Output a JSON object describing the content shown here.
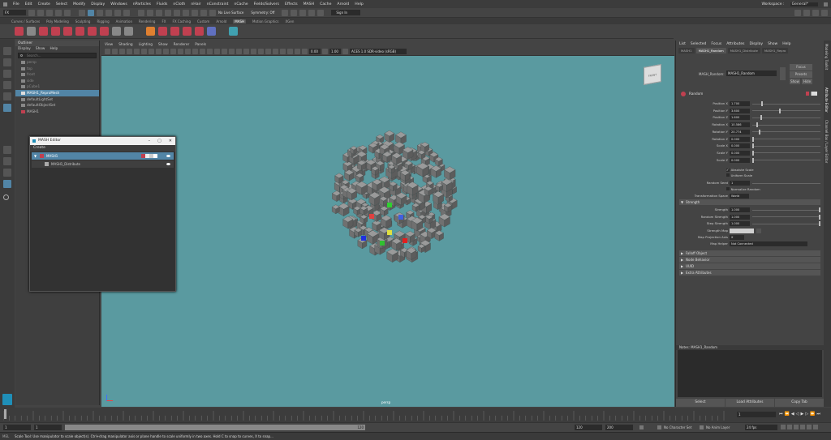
{
  "menubar": {
    "items": [
      "File",
      "Edit",
      "Create",
      "Select",
      "Modify",
      "Display",
      "Windows",
      "nParticles",
      "Fluids",
      "nCloth",
      "nHair",
      "nConstraint",
      "nCache",
      "Fields/Solvers",
      "Effects",
      "MASH",
      "Cache",
      "Arnold",
      "Help"
    ],
    "workspace_label": "Workspace :",
    "workspace_value": "General*"
  },
  "statusline": {
    "mode": "FX",
    "live_surface": "No Live Surface",
    "symmetry": "Symmetry: Off",
    "sign_in": "Sign In"
  },
  "shelf_tabs": [
    "Curves / Surfaces",
    "Poly Modeling",
    "Sculpting",
    "Rigging",
    "Animation",
    "Rendering",
    "FX",
    "FX Caching",
    "Custom",
    "Arnold",
    "MASH",
    "Motion Graphics",
    "XGen"
  ],
  "shelf_active": "MASH",
  "outliner": {
    "title": "Outliner",
    "menu": [
      "Display",
      "Show",
      "Help"
    ],
    "search_placeholder": "Search...",
    "items": [
      {
        "label": "persp",
        "selected": false
      },
      {
        "label": "top",
        "selected": false
      },
      {
        "label": "front",
        "selected": false
      },
      {
        "label": "side",
        "selected": false
      },
      {
        "label": "pCube1",
        "selected": false
      },
      {
        "label": "MASH1_ReproMesh",
        "selected": true
      },
      {
        "label": "defaultLightSet",
        "selected": false
      },
      {
        "label": "defaultObjectSet",
        "selected": false
      },
      {
        "label": "MASH1",
        "selected": false
      }
    ]
  },
  "viewport": {
    "menu": [
      "View",
      "Shading",
      "Lighting",
      "Show",
      "Renderer",
      "Panels"
    ],
    "exposure": "0.00",
    "gamma": "1.00",
    "colorspace": "ACES 1.0 SDR-video (sRGB)",
    "camera_label": "persp",
    "viewcube_label": "FRONT"
  },
  "mash_editor": {
    "title": "MASH Editor",
    "menu": "Create",
    "network": "MASH1",
    "node": "MASH1_Distribute",
    "controls": [
      "–",
      "▢",
      "✕"
    ]
  },
  "attribute_editor": {
    "menu": [
      "List",
      "Selected",
      "Focus",
      "Attributes",
      "Display",
      "Show",
      "Help"
    ],
    "tabs": [
      "MASH1",
      "MASH1_Random",
      "MASH1_Distribute",
      "MASH1_Repro"
    ],
    "active_tab": "MASH1_Random",
    "node_label": "MASH_Random:",
    "node_value": "MASH1_Random",
    "focus_label": "Focus",
    "presets_label": "Presets",
    "show_label": "Show",
    "hide_label": "Hide",
    "section_random": "Random",
    "fields": [
      {
        "label": "Position X",
        "value": "1.700",
        "fraction": 0.14
      },
      {
        "label": "Position Y",
        "value": "3.600",
        "fraction": 0.4
      },
      {
        "label": "Position Z",
        "value": "1.600",
        "fraction": 0.12
      },
      {
        "label": "Rotation X",
        "value": "10.586",
        "fraction": 0.06
      },
      {
        "label": "Rotation Y",
        "value": "20.774",
        "fraction": 0.1
      },
      {
        "label": "Rotation Z",
        "value": "0.000",
        "fraction": 0.0
      },
      {
        "label": "Scale X",
        "value": "0.000",
        "fraction": 0.0
      },
      {
        "label": "Scale Y",
        "value": "0.000",
        "fraction": 0.0
      },
      {
        "label": "Scale Z",
        "value": "0.000",
        "fraction": 0.0
      }
    ],
    "absolute_scale": "Absolute Scale",
    "uniform_scale": "Uniform Scale",
    "random_seed_label": "Random Seed",
    "random_seed_value": "1",
    "normalize_random": "Normalize Random",
    "transformation_space_label": "Transformation Space",
    "transformation_space_value": "World",
    "section_strength": "Strength",
    "strength_fields": [
      {
        "label": "Strength",
        "value": "1.000",
        "fraction": 1.0
      },
      {
        "label": "Random Strength",
        "value": "1.000",
        "fraction": 1.0
      },
      {
        "label": "Step Strength",
        "value": "1.000",
        "fraction": 1.0
      }
    ],
    "strength_map_label": "Strength Map",
    "map_projection_label": "Map Projection Axis",
    "map_projection_value": "X",
    "map_helper_label": "Map Helper",
    "map_helper_value": "Not Connected",
    "collapsed_sections": [
      "Falloff Object",
      "Node Behavior",
      "UUID",
      "Extra Attributes"
    ],
    "notes_label": "Notes: MASH1_Random",
    "bottom_buttons": [
      "Select",
      "Load Attributes",
      "Copy Tab"
    ],
    "side_tabs": [
      "Attribute Editor",
      "Channel Box / Layer Editor",
      "Modeling Toolkit"
    ]
  },
  "timeline": {
    "current_frame": "1",
    "range_start": "1",
    "range_inner_start": "1",
    "range_inner_end": "120",
    "range_end": "120",
    "anim_end": "200",
    "character_set": "No Character Set",
    "anim_layer": "No Anim Layer",
    "fps": "24 fps"
  },
  "command_line": {
    "language": "MEL",
    "message": "Scale Tool: Use manipulator to scale object(s). Ctrl+drag manipulator axis or plane handle to scale uniformly in two axes. Hold C to snap to curves, X to snap..."
  },
  "colors": {
    "viewport_bg": "#5a9aa0",
    "selection": "#5285a6",
    "mash_red": "#c04050"
  }
}
